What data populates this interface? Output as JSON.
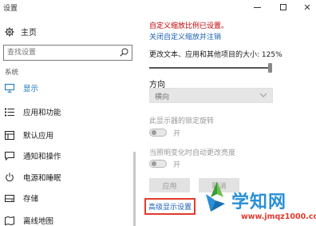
{
  "window": {
    "title": "设置",
    "minimize_icon": "minimize-icon",
    "maximize_icon": "maximize-icon",
    "close_icon": "close-icon"
  },
  "sidebar": {
    "home_label": "主页",
    "search_placeholder": "查找设置",
    "section_label": "系统",
    "items": [
      {
        "label": "显示",
        "icon": "monitor-icon",
        "active": true
      },
      {
        "label": "应用和功能",
        "icon": "list-icon",
        "active": false
      },
      {
        "label": "默认应用",
        "icon": "default-apps-icon",
        "active": false
      },
      {
        "label": "通知和操作",
        "icon": "notification-icon",
        "active": false
      },
      {
        "label": "电源和睡眠",
        "icon": "power-icon",
        "active": false
      },
      {
        "label": "存储",
        "icon": "storage-icon",
        "active": false
      },
      {
        "label": "离线地图",
        "icon": "map-icon",
        "active": false
      }
    ]
  },
  "main": {
    "custom_scale_warning": "自定义缩放比例已设置。",
    "turn_off_custom_scale_link": "关闭自定义缩放并注销",
    "scale_label": "更改文本、应用和其他项目的大小: 125%",
    "scale_slider_value": 1.0,
    "orientation_label": "方向",
    "orientation_value": "横向",
    "rotation_lock_label": "此显示器的锁定旋转",
    "rotation_lock_state": "开",
    "auto_brightness_label": "当照明变化时自动更改亮度",
    "auto_brightness_state": "开",
    "apply_button": "应用",
    "cancel_button": "取消",
    "advanced_display_link": "高级显示设置"
  },
  "watermark": {
    "brand": "学知网",
    "site": "www.jmqz1000.com"
  },
  "colors": {
    "accent": "#1a73b8",
    "warning": "#c00000",
    "highlight_box": "#e23b2b"
  }
}
